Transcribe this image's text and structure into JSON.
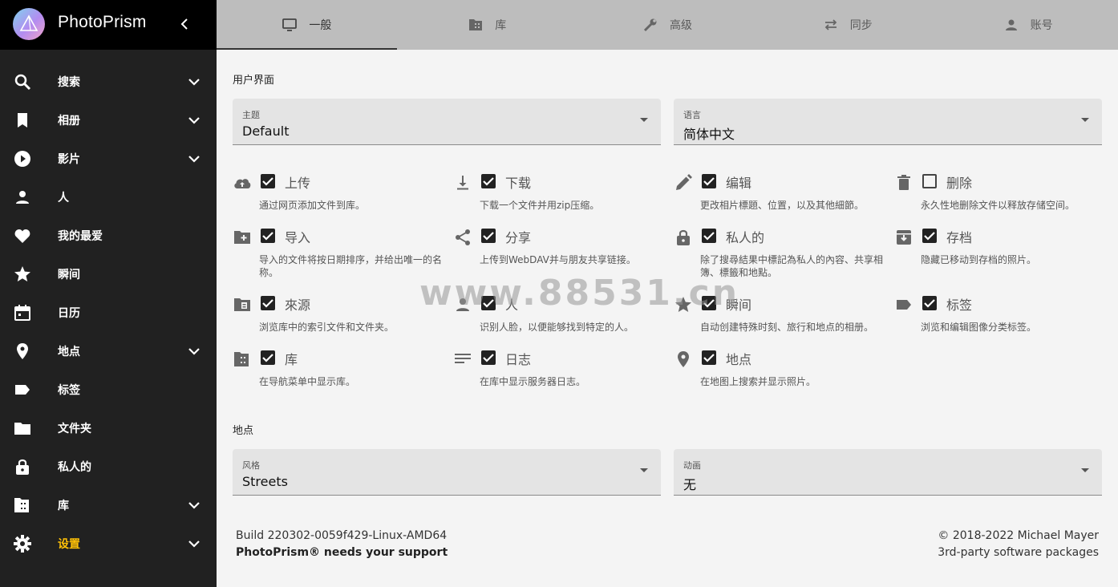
{
  "app": {
    "title": "PhotoPrism"
  },
  "sidebar": {
    "items": [
      {
        "label": "搜索",
        "icon": "search-icon",
        "chevron": true
      },
      {
        "label": "相册",
        "icon": "bookmark-icon",
        "chevron": true
      },
      {
        "label": "影片",
        "icon": "play-icon",
        "chevron": true
      },
      {
        "label": "人",
        "icon": "person-icon",
        "chevron": false
      },
      {
        "label": "我的最爱",
        "icon": "heart-icon",
        "chevron": false
      },
      {
        "label": "瞬间",
        "icon": "star-icon",
        "chevron": false
      },
      {
        "label": "日历",
        "icon": "calendar-icon",
        "chevron": false
      },
      {
        "label": "地点",
        "icon": "place-icon",
        "chevron": true
      },
      {
        "label": "标签",
        "icon": "label-icon",
        "chevron": false
      },
      {
        "label": "文件夹",
        "icon": "folder-icon",
        "chevron": false
      },
      {
        "label": "私人的",
        "icon": "lock-icon",
        "chevron": false
      },
      {
        "label": "库",
        "icon": "library-icon",
        "chevron": true
      },
      {
        "label": "设置",
        "icon": "gear-icon",
        "chevron": true,
        "active": true
      }
    ]
  },
  "tabs": [
    {
      "label": "一般",
      "icon": "monitor-icon",
      "active": true
    },
    {
      "label": "库",
      "icon": "film-folder-icon"
    },
    {
      "label": "高级",
      "icon": "wrench-icon"
    },
    {
      "label": "同步",
      "icon": "sync-arrows-icon"
    },
    {
      "label": "账号",
      "icon": "account-icon"
    }
  ],
  "ui_section": {
    "title": "用户界面",
    "theme": {
      "label": "主题",
      "value": "Default"
    },
    "language": {
      "label": "语言",
      "value": "简体中文"
    }
  },
  "options": [
    {
      "label": "上传",
      "desc": "通过网页添加文件到库。",
      "checked": true,
      "icon": "cloud-upload-icon"
    },
    {
      "label": "下载",
      "desc": "下载一个文件并用zip压缩。",
      "checked": true,
      "icon": "download-icon"
    },
    {
      "label": "编辑",
      "desc": "更改相片標題、位置，以及其他細節。",
      "checked": true,
      "icon": "pencil-icon"
    },
    {
      "label": "删除",
      "desc": "永久性地删除文件以释放存储空间。",
      "checked": false,
      "icon": "trash-icon"
    },
    {
      "label": "导入",
      "desc": "导入的文件将按日期排序，并给出唯一的名称。",
      "checked": true,
      "icon": "folder-plus-icon"
    },
    {
      "label": "分享",
      "desc": "上传到WebDAV并与朋友共享链接。",
      "checked": true,
      "icon": "share-icon"
    },
    {
      "label": "私人的",
      "desc": "除了搜尋結果中標記為私人的內容、共享相簿、標籤和地點。",
      "checked": true,
      "icon": "lock-icon"
    },
    {
      "label": "存档",
      "desc": "隐藏已移动到存档的照片。",
      "checked": true,
      "icon": "archive-icon"
    },
    {
      "label": "來源",
      "desc": "浏览库中的索引文件和文件夹。",
      "checked": true,
      "icon": "folder-file-icon"
    },
    {
      "label": "人",
      "desc": "识别人脸，以便能够找到特定的人。",
      "checked": true,
      "icon": "person-icon"
    },
    {
      "label": "瞬间",
      "desc": "自动创建特殊时刻、旅行和地点的相册。",
      "checked": true,
      "icon": "star-icon"
    },
    {
      "label": "标签",
      "desc": "浏览和编辑图像分类标签。",
      "checked": true,
      "icon": "label-icon"
    },
    {
      "label": "库",
      "desc": "在导航菜单中显示库。",
      "checked": true,
      "icon": "library-icon"
    },
    {
      "label": "日志",
      "desc": "在库中显示服务器日志。",
      "checked": true,
      "icon": "lines-icon"
    },
    {
      "label": "地点",
      "desc": "在地图上搜索并显示照片。",
      "checked": true,
      "icon": "place-icon"
    }
  ],
  "places_section": {
    "title": "地点",
    "style": {
      "label": "风格",
      "value": "Streets"
    },
    "animation": {
      "label": "动画",
      "value": "无"
    }
  },
  "footer": {
    "build": "Build 220302-0059f429-Linux-AMD64",
    "support": "PhotoPrism® needs your support",
    "copyright": "© 2018-2022 Michael Mayer",
    "packages": "3rd-party software packages"
  },
  "watermark": "www.88531.cn",
  "colors": {
    "sidebar": "#212121",
    "brand_bar": "#000000",
    "accent": "#ffc107",
    "tabs_bg": "#bdbdbd",
    "content_bg": "#f4f4f4"
  }
}
